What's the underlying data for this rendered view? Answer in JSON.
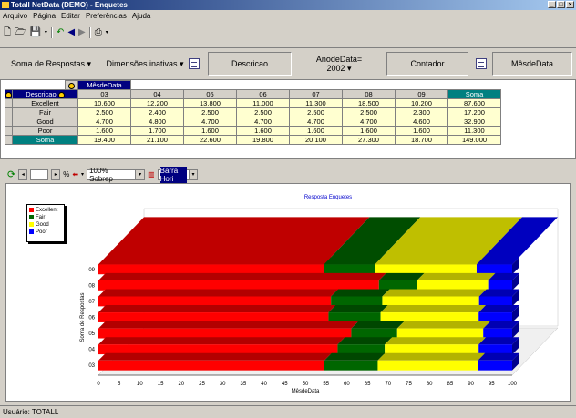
{
  "window": {
    "title": "Totall NetData (DEMO) - Enquetes"
  },
  "menu": [
    "Arquivo",
    "Página",
    "Editar",
    "Preferências",
    "Ajuda"
  ],
  "pivot": {
    "measure_label": "Soma de Respostas",
    "dimensions_label": "Dimensões inativas",
    "field_descricao": "Descricao",
    "field_anodedata_line1": "AnodeData=",
    "field_anodedata_line2": "2002",
    "field_contador": "Contador",
    "field_mesdedata": "MêsdeData"
  },
  "table": {
    "col_dim_label": "MêsdeData",
    "row_dim_label": "Descricao",
    "columns": [
      "03",
      "04",
      "05",
      "06",
      "07",
      "08",
      "09"
    ],
    "total_label": "Soma",
    "rows": [
      {
        "label": "Excellent",
        "values": [
          "10.600",
          "12.200",
          "13.800",
          "11.000",
          "11.300",
          "18.500",
          "10.200"
        ],
        "total": "87.600"
      },
      {
        "label": "Fair",
        "values": [
          "2.500",
          "2.400",
          "2.500",
          "2.500",
          "2.500",
          "2.500",
          "2.300"
        ],
        "total": "17.200"
      },
      {
        "label": "Good",
        "values": [
          "4.700",
          "4.800",
          "4.700",
          "4.700",
          "4.700",
          "4.700",
          "4.600"
        ],
        "total": "32.900"
      },
      {
        "label": "Poor",
        "values": [
          "1.600",
          "1.700",
          "1.600",
          "1.600",
          "1.600",
          "1.600",
          "1.600"
        ],
        "total": "11.300"
      },
      {
        "label": "Soma",
        "values": [
          "19.400",
          "21.100",
          "22.600",
          "19.800",
          "20.100",
          "27.300",
          "18.700"
        ],
        "total": "149.000"
      }
    ]
  },
  "charttoolbar": {
    "zoom": "100% Sobrep",
    "charttype": "Barra Hori"
  },
  "chart_data": {
    "type": "bar",
    "orientation": "horizontal-stacked-percent",
    "title": "Resposta Enquetes",
    "xlabel": "MêsdeData",
    "ylabel": "Soma de Respostas",
    "categories": [
      "03",
      "04",
      "05",
      "06",
      "07",
      "08",
      "09"
    ],
    "xticks": [
      "0",
      "5",
      "10",
      "15",
      "20",
      "25",
      "30",
      "35",
      "40",
      "45",
      "50",
      "55",
      "60",
      "65",
      "70",
      "75",
      "80",
      "85",
      "90",
      "95",
      "100"
    ],
    "xlim": [
      0,
      100
    ],
    "legend_position": "top-left",
    "series": [
      {
        "name": "Excellent",
        "color": "#ff0000",
        "values": [
          54.6,
          57.8,
          61.1,
          55.6,
          56.2,
          67.8,
          54.5
        ]
      },
      {
        "name": "Fair",
        "color": "#006600",
        "values": [
          12.9,
          11.4,
          11.1,
          12.6,
          12.4,
          9.2,
          12.3
        ]
      },
      {
        "name": "Good",
        "color": "#ffff00",
        "values": [
          24.2,
          22.7,
          20.8,
          23.7,
          23.4,
          17.2,
          24.6
        ]
      },
      {
        "name": "Poor",
        "color": "#0000ff",
        "values": [
          8.3,
          8.1,
          7.0,
          8.1,
          8.0,
          5.8,
          8.6
        ]
      }
    ]
  },
  "status": {
    "user": "Usuário: TOTALL"
  }
}
